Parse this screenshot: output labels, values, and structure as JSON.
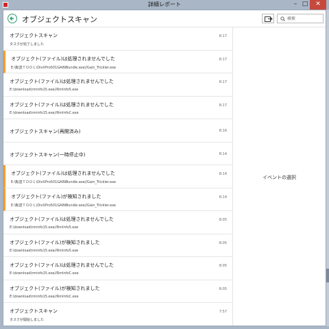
{
  "window": {
    "title": "詳細レポート"
  },
  "header": {
    "title": "オブジェクトスキャン",
    "search_placeholder": "検索"
  },
  "detail": {
    "placeholder": "イベントの選択"
  },
  "items": [
    {
      "title": "オブジェクトスキャン",
      "sub": "タスクが完了しました",
      "time": "8:17",
      "warn": false
    },
    {
      "title": "オブジェクト(ファイル)は処理されませんでした",
      "sub": "E:\\転送ＴＯＯＬ\\DivXPro501GAINBundle.exe//Gain_Trickler.exe",
      "time": "8:17",
      "warn": true
    },
    {
      "title": "オブジェクト(ファイル)は処理されませんでした",
      "sub": "E:\\download\\rminfo15.exe//RmInfo5.exe",
      "time": "8:17",
      "warn": false
    },
    {
      "title": "オブジェクト(ファイル)は処理されませんでした",
      "sub": "E:\\download\\rminfo15.exe//RmInfoC.exe",
      "time": "8:17",
      "warn": false
    },
    {
      "title": "オブジェクトスキャン(再開済み)",
      "sub": "",
      "time": "8:16",
      "warn": false
    },
    {
      "title": "オブジェクトスキャン(一時停止中)",
      "sub": "",
      "time": "8:14",
      "warn": false
    },
    {
      "title": "オブジェクト(ファイル)は処理されませんでした",
      "sub": "E:\\転送ＴＯＯＬ\\DivXPro501GAINBundle.exe//Gain_Trickler.exe",
      "time": "8:14",
      "warn": true
    },
    {
      "title": "オブジェクト(ファイル)が検知されました",
      "sub": "E:\\転送ＴＯＯＬ\\DivXPro501GAINBundle.exe//Gain_Trickler.exe",
      "time": "8:14",
      "warn": true
    },
    {
      "title": "オブジェクト(ファイル)は処理されませんでした",
      "sub": "E:\\download\\rminfo15.exe//RmInfo5.exe",
      "time": "8:05",
      "warn": false
    },
    {
      "title": "オブジェクト(ファイル)が検知されました",
      "sub": "E:\\download\\rminfo15.exe//RmInfo5.exe",
      "time": "8:05",
      "warn": false
    },
    {
      "title": "オブジェクト(ファイル)は処理されませんでした",
      "sub": "E:\\download\\rminfo15.exe//RmInfoC.exe",
      "time": "8:05",
      "warn": false
    },
    {
      "title": "オブジェクト(ファイル)が検知されました",
      "sub": "E:\\download\\rminfo15.exe//RmInfoC.exe",
      "time": "8:05",
      "warn": false
    },
    {
      "title": "オブジェクトスキャン",
      "sub": "タスクが開始しました",
      "time": "7:57",
      "warn": false
    }
  ],
  "colors": {
    "warn": "#f39c2c",
    "accent": "#2e9b6e",
    "close": "#c7493d"
  },
  "icons": {
    "back": "back-arrow-icon",
    "export": "export-icon",
    "search": "search-icon"
  }
}
